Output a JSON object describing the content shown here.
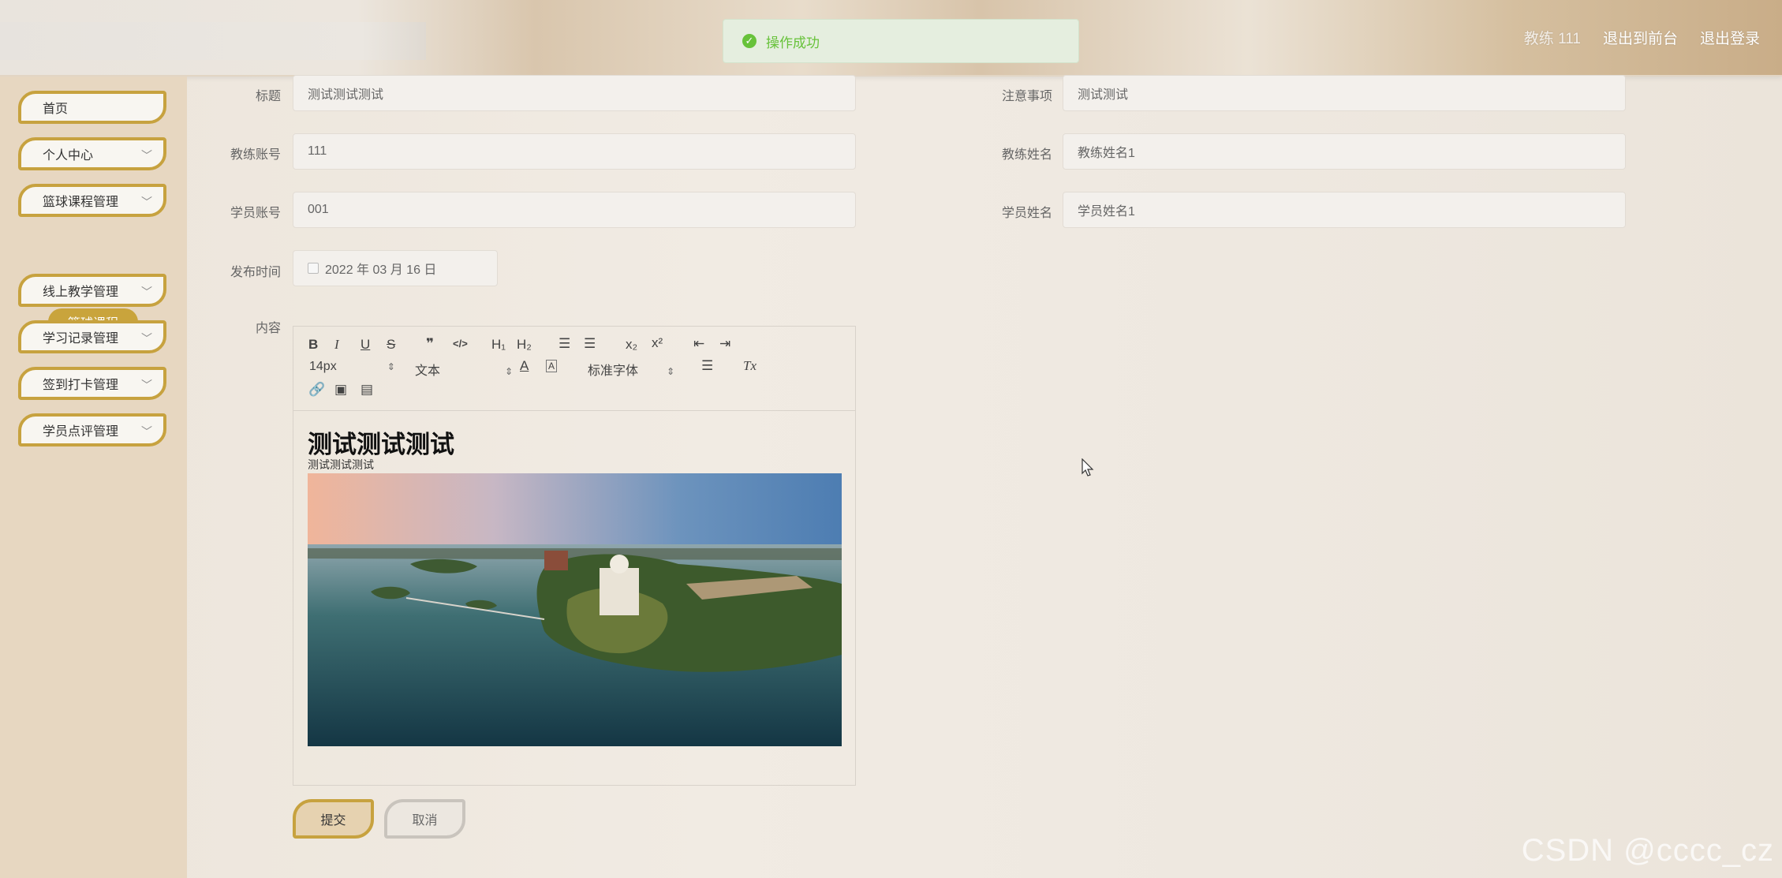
{
  "header": {
    "user_label": "教练 111",
    "back_to_front": "退出到前台",
    "logout": "退出登录"
  },
  "toast": {
    "message": "操作成功",
    "icon": "check-circle-icon",
    "color": "#67c23a"
  },
  "sidebar": {
    "accent_color": "#c7a23f",
    "items": [
      {
        "label": "首页",
        "has_chevron": false
      },
      {
        "label": "个人中心",
        "has_chevron": true
      },
      {
        "label": "篮球课程管理",
        "has_chevron": true
      },
      {
        "label": "线上教学管理",
        "has_chevron": true
      },
      {
        "label": "学习记录管理",
        "has_chevron": true
      },
      {
        "label": "签到打卡管理",
        "has_chevron": true
      },
      {
        "label": "学员点评管理",
        "has_chevron": true
      }
    ],
    "sub_item": {
      "label": "篮球课程"
    }
  },
  "form": {
    "title_label": "标题",
    "title_value": "测试测试测试",
    "notes_label": "注意事项",
    "notes_value": "测试测试",
    "coach_account_label": "教练账号",
    "coach_account_value": "111",
    "coach_name_label": "教练姓名",
    "coach_name_value": "教练姓名1",
    "student_account_label": "学员账号",
    "student_account_value": "001",
    "student_name_label": "学员姓名",
    "student_name_value": "学员姓名1",
    "publish_time_label": "发布时间",
    "publish_time_value": "2022 年 03 月 16 日",
    "content_label": "内容"
  },
  "editor": {
    "toolbar": {
      "bold": "B",
      "italic": "I",
      "underline": "U",
      "strike": "S",
      "quote": "❞",
      "code": "</>",
      "h1": "H₁",
      "h2": "H₂",
      "subscript": "x₂",
      "superscript": "x²",
      "font_size": "14px",
      "block_type": "文本",
      "font_family": "标准字体",
      "clean": "Tx"
    },
    "content_heading": "测试测试测试",
    "content_paragraph": "测试测试测试"
  },
  "buttons": {
    "submit": "提交",
    "cancel": "取消"
  },
  "watermark": "CSDN @cccc_cz"
}
